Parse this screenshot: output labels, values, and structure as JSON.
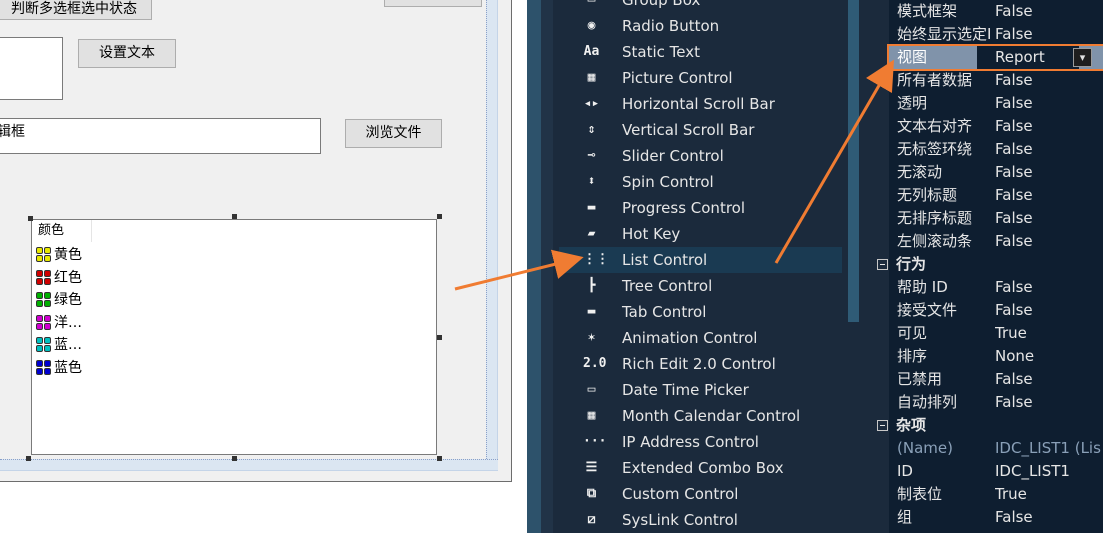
{
  "designer": {
    "check_button_label": "判断多选框选中状态",
    "set_text_button_label": "设置文本",
    "path_edit_text": "辑框",
    "browse_button_label": "浏览文件",
    "list": {
      "column_header": "颜色",
      "rows": [
        {
          "label": "黄色",
          "color": "#e8e800"
        },
        {
          "label": "红色",
          "color": "#d00000"
        },
        {
          "label": "绿色",
          "color": "#00b000"
        },
        {
          "label": "洋…",
          "color": "#d000d0"
        },
        {
          "label": "蓝…",
          "color": "#00c0c0"
        },
        {
          "label": "蓝色",
          "color": "#0000d0"
        }
      ]
    }
  },
  "toolbox": {
    "items": [
      {
        "label": "Group Box",
        "icon": "group-box-icon",
        "glyph": "▭"
      },
      {
        "label": "Radio Button",
        "icon": "radio-button-icon",
        "glyph": "◉"
      },
      {
        "label": "Static Text",
        "icon": "static-text-icon",
        "glyph": "Aa"
      },
      {
        "label": "Picture Control",
        "icon": "picture-control-icon",
        "glyph": "▦"
      },
      {
        "label": "Horizontal Scroll Bar",
        "icon": "horizontal-scroll-bar-icon",
        "glyph": "◂▸"
      },
      {
        "label": "Vertical Scroll Bar",
        "icon": "vertical-scroll-bar-icon",
        "glyph": "⇕"
      },
      {
        "label": "Slider Control",
        "icon": "slider-control-icon",
        "glyph": "⊸"
      },
      {
        "label": "Spin Control",
        "icon": "spin-control-icon",
        "glyph": "⬍"
      },
      {
        "label": "Progress Control",
        "icon": "progress-control-icon",
        "glyph": "▬"
      },
      {
        "label": "Hot Key",
        "icon": "hot-key-icon",
        "glyph": "▰"
      },
      {
        "label": "List Control",
        "icon": "list-control-icon",
        "glyph": "⋮⋮"
      },
      {
        "label": "Tree Control",
        "icon": "tree-control-icon",
        "glyph": "┣"
      },
      {
        "label": "Tab Control",
        "icon": "tab-control-icon",
        "glyph": "▬"
      },
      {
        "label": "Animation Control",
        "icon": "animation-control-icon",
        "glyph": "✶"
      },
      {
        "label": "Rich Edit 2.0 Control",
        "icon": "rich-edit-icon",
        "glyph": "2.0"
      },
      {
        "label": "Date Time Picker",
        "icon": "date-time-picker-icon",
        "glyph": "▭"
      },
      {
        "label": "Month Calendar Control",
        "icon": "month-calendar-icon",
        "glyph": "▦"
      },
      {
        "label": "IP Address Control",
        "icon": "ip-address-icon",
        "glyph": "···"
      },
      {
        "label": "Extended Combo Box",
        "icon": "extended-combo-box-icon",
        "glyph": "☰"
      },
      {
        "label": "Custom Control",
        "icon": "custom-control-icon",
        "glyph": "⧉"
      },
      {
        "label": "SysLink Control",
        "icon": "syslink-control-icon",
        "glyph": "⧄"
      }
    ],
    "selected": "List Control"
  },
  "properties": {
    "appearance_rows": [
      {
        "name": "模式框架",
        "value": "False"
      },
      {
        "name": "始终显示选定I",
        "value": "False"
      },
      {
        "name": "视图",
        "value": "Report"
      },
      {
        "name": "所有者数据",
        "value": "False"
      },
      {
        "name": "透明",
        "value": "False"
      },
      {
        "name": "文本右对齐",
        "value": "False"
      },
      {
        "name": "无标签环绕",
        "value": "False"
      },
      {
        "name": "无滚动",
        "value": "False"
      },
      {
        "name": "无列标题",
        "value": "False"
      },
      {
        "name": "无排序标题",
        "value": "False"
      },
      {
        "name": "左侧滚动条",
        "value": "False"
      }
    ],
    "behavior_category": "行为",
    "behavior_rows": [
      {
        "name": "帮助 ID",
        "value": "False"
      },
      {
        "name": "接受文件",
        "value": "False"
      },
      {
        "name": "可见",
        "value": "True"
      },
      {
        "name": "排序",
        "value": "None"
      },
      {
        "name": "已禁用",
        "value": "False"
      },
      {
        "name": "自动排列",
        "value": "False"
      }
    ],
    "misc_category": "杂项",
    "misc_rows": [
      {
        "name": "(Name)",
        "value": "IDC_LIST1 (Lis"
      },
      {
        "name": "ID",
        "value": "IDC_LIST1"
      },
      {
        "name": "制表位",
        "value": "True"
      },
      {
        "name": "组",
        "value": "False"
      }
    ],
    "accent_color": "#f07c32"
  }
}
